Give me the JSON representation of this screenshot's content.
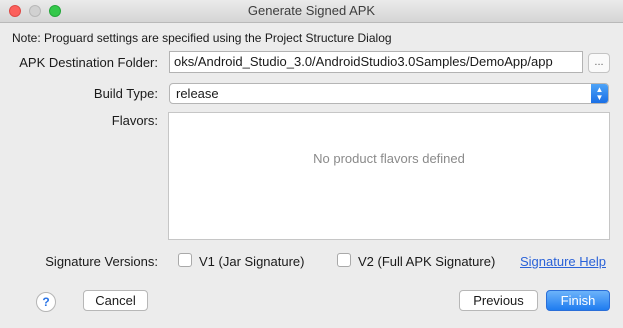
{
  "window": {
    "title": "Generate Signed APK"
  },
  "note": "Note: Proguard settings are specified using the Project Structure Dialog",
  "destination": {
    "label": "APK Destination Folder:",
    "value": "oks/Android_Studio_3.0/AndroidStudio3.0Samples/DemoApp/app",
    "browse_label": "..."
  },
  "build_type": {
    "label": "Build Type:",
    "value": "release"
  },
  "flavors": {
    "label": "Flavors:",
    "empty_text": "No product flavors defined"
  },
  "signature": {
    "label": "Signature Versions:",
    "v1_label": "V1 (Jar Signature)",
    "v2_label": "V2 (Full APK Signature)",
    "v1_checked": false,
    "v2_checked": false,
    "help_link": "Signature Help"
  },
  "buttons": {
    "help": "?",
    "cancel": "Cancel",
    "previous": "Previous",
    "finish": "Finish"
  },
  "colors": {
    "accent": "#1f7cf0",
    "link": "#2a62d8"
  }
}
